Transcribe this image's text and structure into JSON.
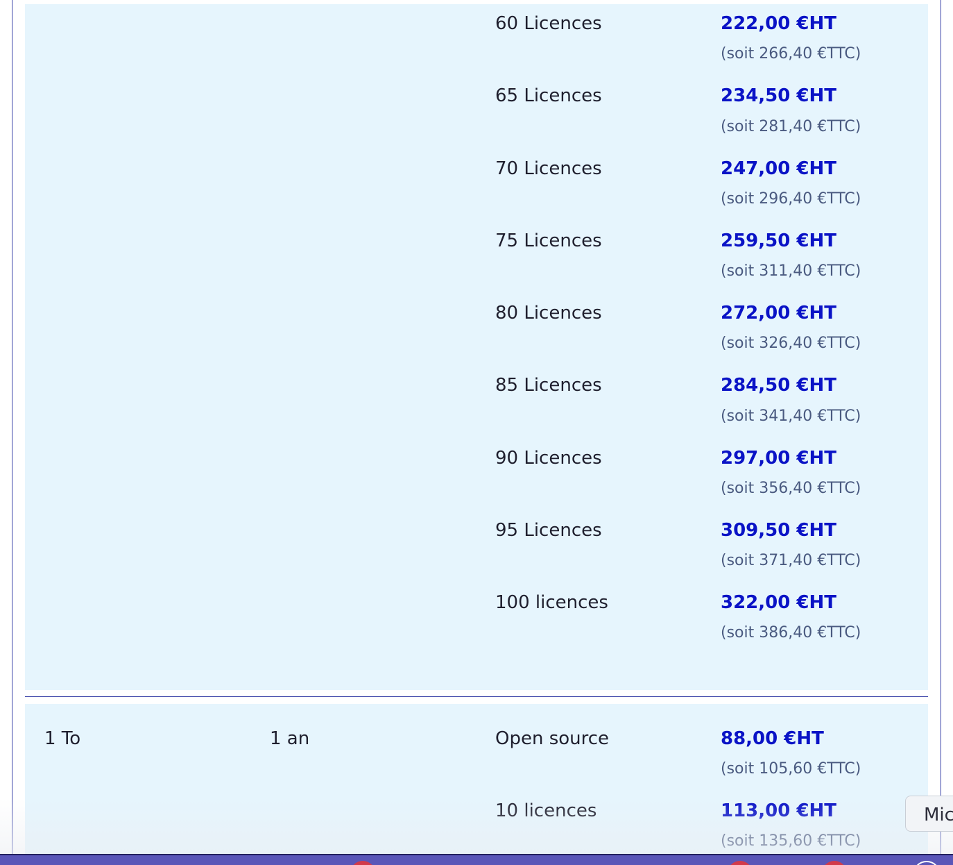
{
  "table": {
    "block1_rows": [
      {
        "licences": "60 Licences",
        "price_ht": "222,00 €HT",
        "price_ttc": "(soit 266,40 €TTC)"
      },
      {
        "licences": "65 Licences",
        "price_ht": "234,50 €HT",
        "price_ttc": "(soit 281,40 €TTC)"
      },
      {
        "licences": "70 Licences",
        "price_ht": "247,00 €HT",
        "price_ttc": "(soit 296,40 €TTC)"
      },
      {
        "licences": "75 Licences",
        "price_ht": "259,50 €HT",
        "price_ttc": "(soit 311,40 €TTC)"
      },
      {
        "licences": "80 Licences",
        "price_ht": "272,00 €HT",
        "price_ttc": "(soit 326,40 €TTC)"
      },
      {
        "licences": "85 Licences",
        "price_ht": "284,50 €HT",
        "price_ttc": "(soit 341,40 €TTC)"
      },
      {
        "licences": "90 Licences",
        "price_ht": "297,00 €HT",
        "price_ttc": "(soit 356,40 €TTC)"
      },
      {
        "licences": "95 Licences",
        "price_ht": "309,50 €HT",
        "price_ttc": "(soit 371,40 €TTC)"
      },
      {
        "licences": "100 licences",
        "price_ht": "322,00 €HT",
        "price_ttc": "(soit 386,40 €TTC)"
      }
    ],
    "block2": {
      "storage": "1 To",
      "duration": "1 an",
      "rows": [
        {
          "licences": "Open source",
          "price_ht": "88,00 €HT",
          "price_ttc": "(soit 105,60 €TTC)"
        },
        {
          "licences": "10 licences",
          "price_ht": "113,00 €HT",
          "price_ttc": "(soit 135,60 €TTC)"
        }
      ]
    }
  },
  "chat_widget": {
    "label": "Mic"
  },
  "colors": {
    "price": "#0a13c6",
    "row_background": "#e6f5fd",
    "border": "#3a43a8",
    "taskbar": "#5a56b8"
  }
}
